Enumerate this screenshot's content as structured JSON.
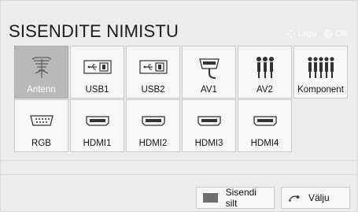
{
  "header": {
    "title": "SISENDITE NIMISTU",
    "hints": [
      {
        "icon": "arrows-icon",
        "label": "Liigu"
      },
      {
        "icon": "ok-icon",
        "label": "OK"
      }
    ]
  },
  "inputs": {
    "row1": [
      "Antenn",
      "USB1",
      "USB2",
      "AV1",
      "AV2",
      "Komponent"
    ],
    "row2": [
      "RGB",
      "HDMI1",
      "HDMI2",
      "HDMI3",
      "HDMI4"
    ],
    "selected": "Antenn"
  },
  "footer": {
    "input_label_button": "Sisendi silt",
    "exit_button": "Välju"
  },
  "colors": {
    "accent_swatch": "#6f6f6f"
  }
}
